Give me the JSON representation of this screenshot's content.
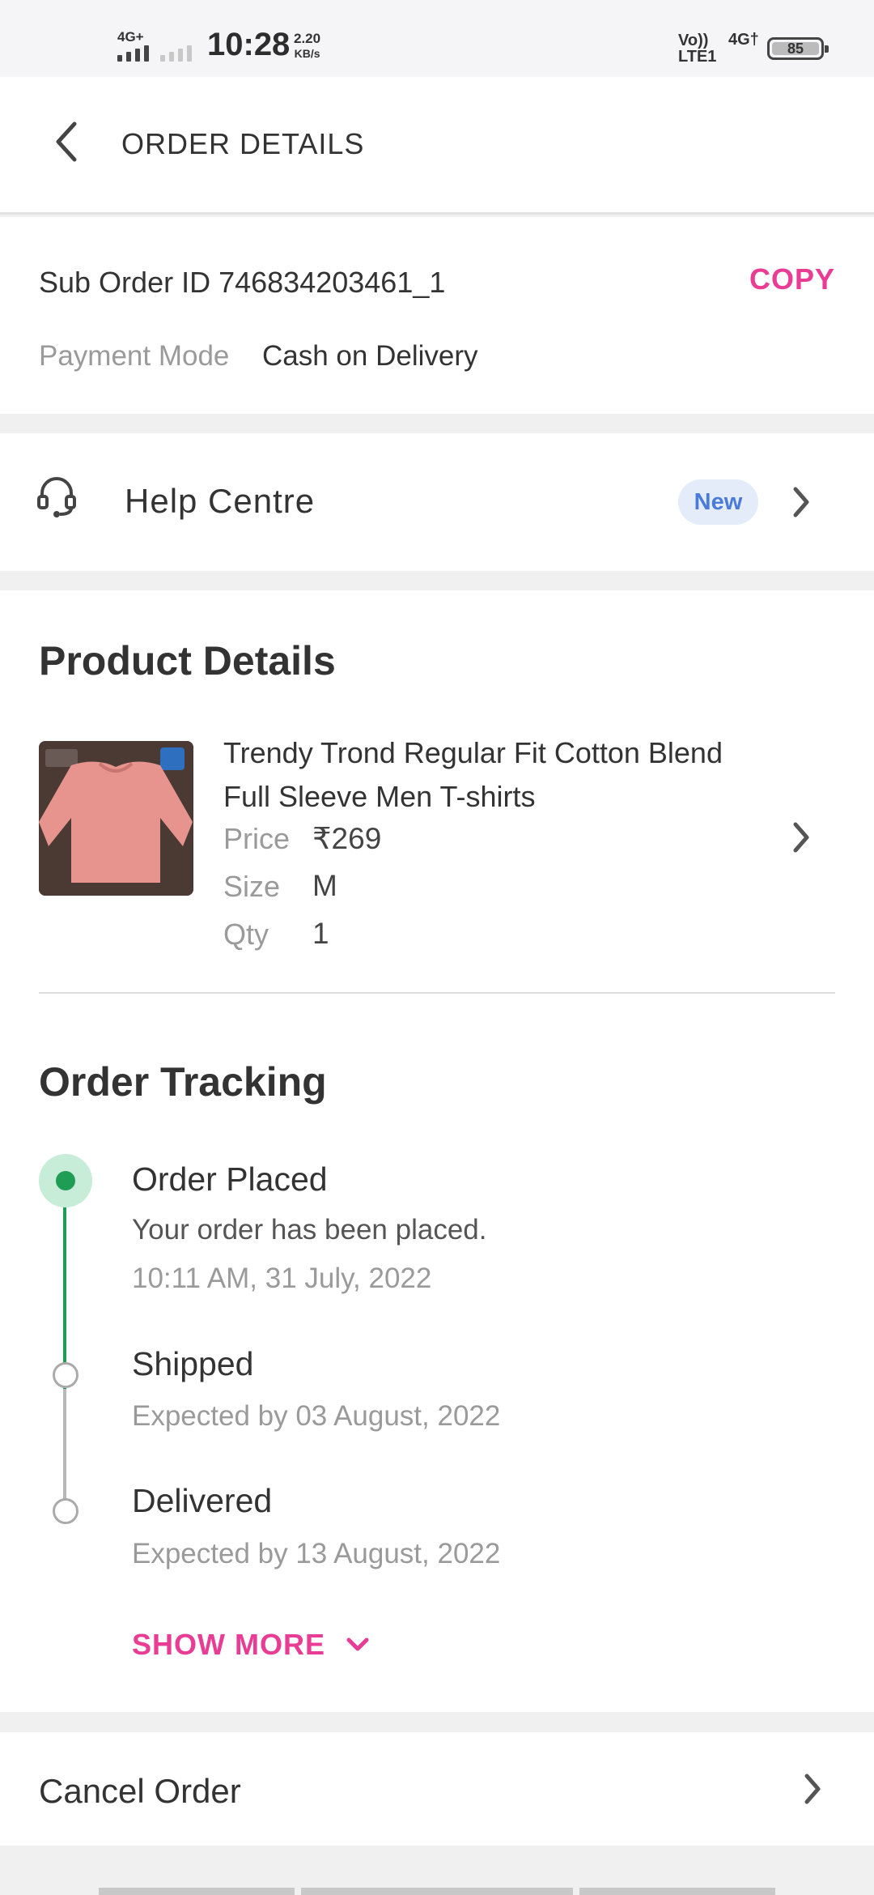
{
  "status_bar": {
    "network1": "4G+",
    "time": "10:28",
    "speed_value": "2.20",
    "speed_unit": "KB/s",
    "volte_line1": "Vo))",
    "volte_line2": "LTE1",
    "network2": "4G†",
    "battery": "85"
  },
  "header": {
    "title": "ORDER DETAILS"
  },
  "order": {
    "sub_order_id": "Sub Order ID 746834203461_1",
    "copy_label": "COPY",
    "payment_label": "Payment Mode",
    "payment_value": "Cash on Delivery"
  },
  "help": {
    "label": "Help Centre",
    "badge": "New"
  },
  "product": {
    "section_title": "Product Details",
    "name": "Trendy Trond Regular Fit Cotton Blend Full Sleeve  Men T-shirts",
    "price_label": "Price",
    "price_value": "₹269",
    "size_label": "Size",
    "size_value": "M",
    "qty_label": "Qty",
    "qty_value": "1",
    "image_color": "#e8948e"
  },
  "tracking": {
    "section_title": "Order Tracking",
    "steps": [
      {
        "title": "Order Placed",
        "line1": "Your order has been placed.",
        "line2": "10:11 AM, 31 July, 2022",
        "status": "done"
      },
      {
        "title": "Shipped",
        "line1": "Expected by 03 August, 2022",
        "status": "pending"
      },
      {
        "title": "Delivered",
        "line1": "Expected by 13 August, 2022",
        "status": "pending"
      }
    ],
    "show_more": "SHOW MORE"
  },
  "cancel": {
    "label": "Cancel Order"
  },
  "colors": {
    "accent": "#e83c95",
    "done": "#1f9d55",
    "badge_bg": "#e4ecfa",
    "badge_text": "#4a7bd8"
  }
}
